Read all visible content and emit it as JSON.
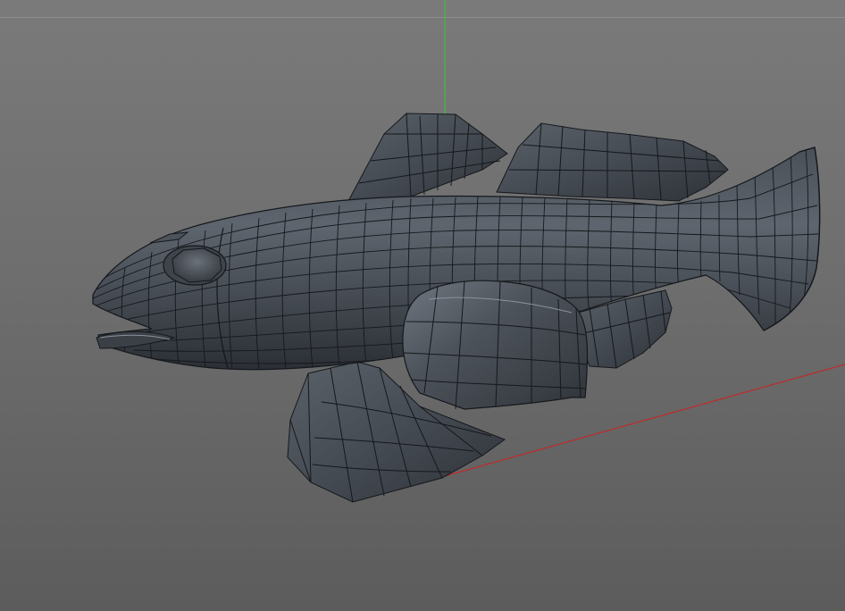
{
  "viewport": {
    "view_mode": "perspective",
    "shading": "gouraud-with-wireframe-lines",
    "background_top": "#7a7a7a",
    "background_bottom": "#5c5c5c"
  },
  "axes": {
    "y_axis_color": "#3fbf3f",
    "x_axis_color": "#c02a2a"
  },
  "model": {
    "object": "fish-mesh",
    "base_color": "#4b5159",
    "wire_color": "#15181c",
    "highlight_color": "#8a929c"
  }
}
